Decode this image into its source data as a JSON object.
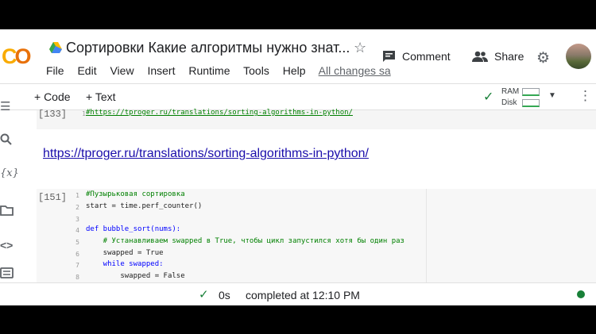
{
  "header": {
    "logo": "CO",
    "title": "Сортировки Какие алгоритмы нужно знат...",
    "comment_label": "Comment",
    "share_label": "Share"
  },
  "menu": {
    "items": [
      "File",
      "Edit",
      "View",
      "Insert",
      "Runtime",
      "Tools",
      "Help"
    ],
    "saved_label": "All changes sa"
  },
  "toolbar": {
    "code_label": "+ Code",
    "text_label": "+ Text",
    "ram_label": "RAM",
    "disk_label": "Disk"
  },
  "rail_icons": [
    "list-icon",
    "search-icon",
    "variables-icon",
    "folder-icon",
    "code-snippet-icon",
    "terminal-icon"
  ],
  "cells": {
    "first": {
      "exec_count": "[133]",
      "line_no": "1",
      "code": "#https://tproger.ru/translations/sorting-algorithms-in-python/"
    },
    "markdown_link": "https://tproger.ru/translations/sorting-algorithms-in-python/",
    "second": {
      "exec_count": "[151]",
      "lines": [
        {
          "n": "1",
          "text": "#Пузырьковая сортировка"
        },
        {
          "n": "2",
          "text": "start = time.perf_counter()"
        },
        {
          "n": "3",
          "text": ""
        },
        {
          "n": "4",
          "text": "def bubble_sort(nums):"
        },
        {
          "n": "5",
          "text": "    # Устанавливаем swapped в True, чтобы цикл запустился хотя бы один раз"
        },
        {
          "n": "6",
          "text": "    swapped = True"
        },
        {
          "n": "7",
          "text": "    while swapped:"
        },
        {
          "n": "8",
          "text": "        swapped = False"
        }
      ]
    }
  },
  "status": {
    "time": "0s",
    "completed": "completed at 12:10 PM"
  },
  "colors": {
    "accent_green": "#188038",
    "logo_orange": "#f9ab00",
    "link_blue": "#1a0dab"
  }
}
